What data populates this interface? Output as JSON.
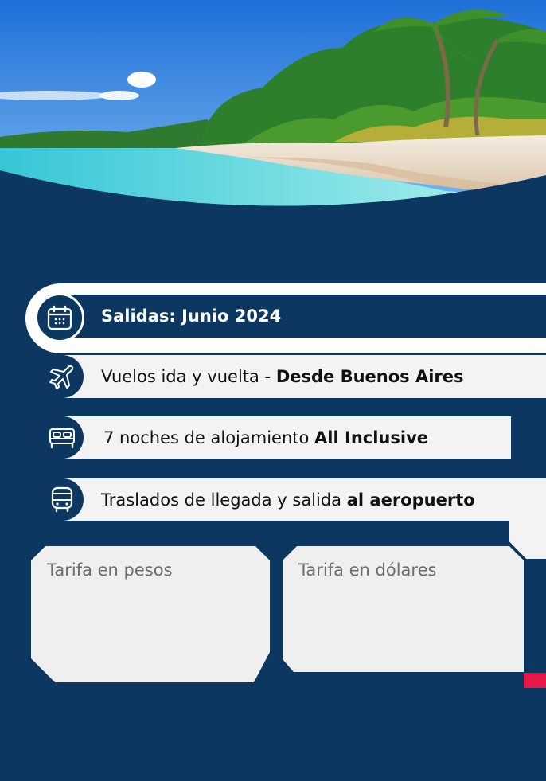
{
  "colors": {
    "background": "#0b3760",
    "pill": "#f3f3f4",
    "card": "#efefef",
    "accent": "#e8184a"
  },
  "departures": {
    "label": "Salidas: Junio 2024",
    "icon": "calendar-icon"
  },
  "features": [
    {
      "icon": "airplane-icon",
      "text": "Vuelos ida y vuelta - ",
      "bold": "Desde Buenos Aires"
    },
    {
      "icon": "bed-icon",
      "text": "7 noches de alojamiento ",
      "bold": "All Inclusive"
    },
    {
      "icon": "bus-icon",
      "text": "Traslados de llegada y salida ",
      "bold": "al aeropuerto"
    }
  ],
  "cards": [
    {
      "label": "Tarifa en pesos"
    },
    {
      "label": "Tarifa en dólares"
    }
  ]
}
